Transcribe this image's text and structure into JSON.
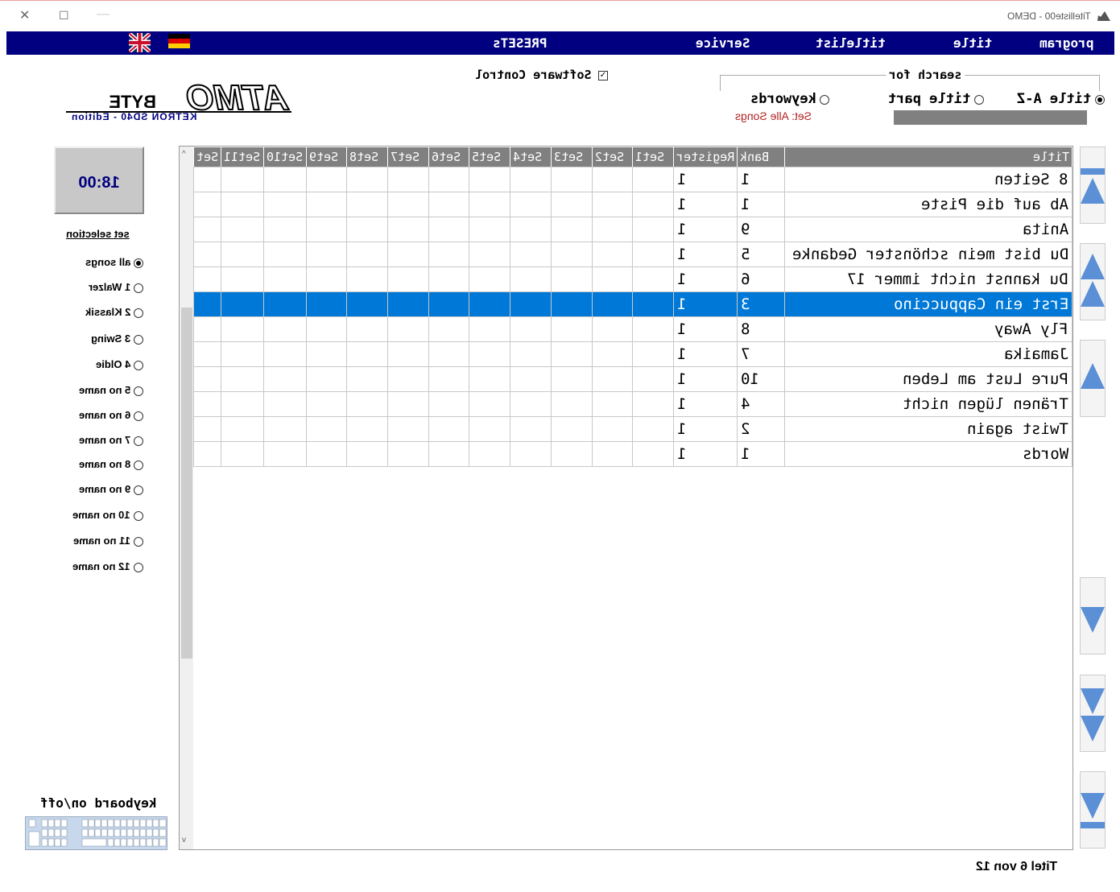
{
  "window": {
    "title": "Titelliste00 - DEMO"
  },
  "menu": {
    "items": [
      "program",
      "title",
      "titlelist",
      "Service",
      "PRESETs"
    ]
  },
  "logo": {
    "main": "ATMO BYTE",
    "sub": "KETRON SD40 - Edition"
  },
  "search": {
    "label": "search for",
    "options": [
      "title A-Z",
      "title part",
      "keywords"
    ],
    "selected": "title A-Z",
    "set_info": "Set: Alle Songs",
    "software_control": "Software Control",
    "software_control_checked": true
  },
  "clock": "18:00",
  "set_selection": {
    "heading": "set selection",
    "items": [
      "all songs",
      "1 Walzer",
      "2 Klassik",
      "3 Swing",
      "4 Oldie",
      "5 no name",
      "6 no name",
      "7 no name",
      "8 no name",
      "9 no name",
      "10 no name",
      "11 no name",
      "12 no name"
    ],
    "selected": "all songs"
  },
  "grid": {
    "columns": [
      "Title",
      "Bank",
      "Register",
      "Set1",
      "Set2",
      "Set3",
      "Set4",
      "Set5",
      "Set6",
      "Set7",
      "Set8",
      "Set9",
      "Set10",
      "Set11",
      "Set"
    ],
    "rows": [
      {
        "title": "8 Seiten",
        "bank": "1",
        "register": "1"
      },
      {
        "title": "Ab auf die Piste",
        "bank": "1",
        "register": "1"
      },
      {
        "title": "Anita",
        "bank": "9",
        "register": "1"
      },
      {
        "title": "Du bist mein schönster Gedanke",
        "bank": "5",
        "register": "1"
      },
      {
        "title": "Du kannst nicht immer 17",
        "bank": "6",
        "register": "1"
      },
      {
        "title": "Erst ein Cappuccino",
        "bank": "3",
        "register": "1"
      },
      {
        "title": "Fly Away",
        "bank": "8",
        "register": "1"
      },
      {
        "title": "Jamaika",
        "bank": "7",
        "register": "1"
      },
      {
        "title": "Pure Lust am Leben",
        "bank": "10",
        "register": "1"
      },
      {
        "title": "Tränen lügen nicht",
        "bank": "4",
        "register": "1"
      },
      {
        "title": "Twist again",
        "bank": "2",
        "register": "1"
      },
      {
        "title": "Words",
        "bank": "1",
        "register": "1"
      }
    ],
    "selected_index": 5
  },
  "keyboard": {
    "label": "keyboard on/off"
  },
  "status": "Titel 6 von 12",
  "colors": {
    "menubar": "#000080",
    "selection": "#0078d7",
    "header": "#808080",
    "nav_arrow": "#5b8fd6"
  }
}
